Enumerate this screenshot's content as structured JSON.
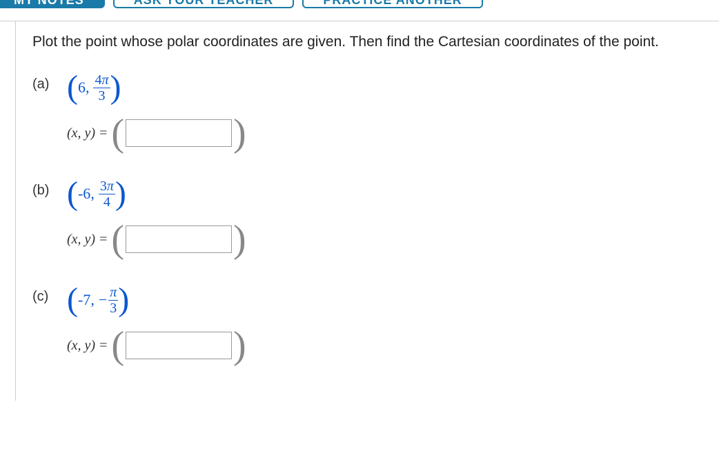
{
  "tabs": {
    "notes": "MY NOTES",
    "ask": "ASK YOUR TEACHER",
    "practice": "PRACTICE ANOTHER"
  },
  "prompt": "Plot the point whose polar coordinates are given. Then find the Cartesian coordinates of the point.",
  "parts": {
    "a": {
      "label": "(a)",
      "r": "6",
      "sign": "",
      "num": "4",
      "den": "3",
      "xy": "(x, y)",
      "eq": "="
    },
    "b": {
      "label": "(b)",
      "r": "-6",
      "sign": "",
      "num": "3",
      "den": "4",
      "xy": "(x, y)",
      "eq": "="
    },
    "c": {
      "label": "(c)",
      "r": "-7",
      "sign": "−",
      "num": "",
      "den": "3",
      "xy": "(x, y)",
      "eq": "="
    }
  },
  "pi": "π"
}
